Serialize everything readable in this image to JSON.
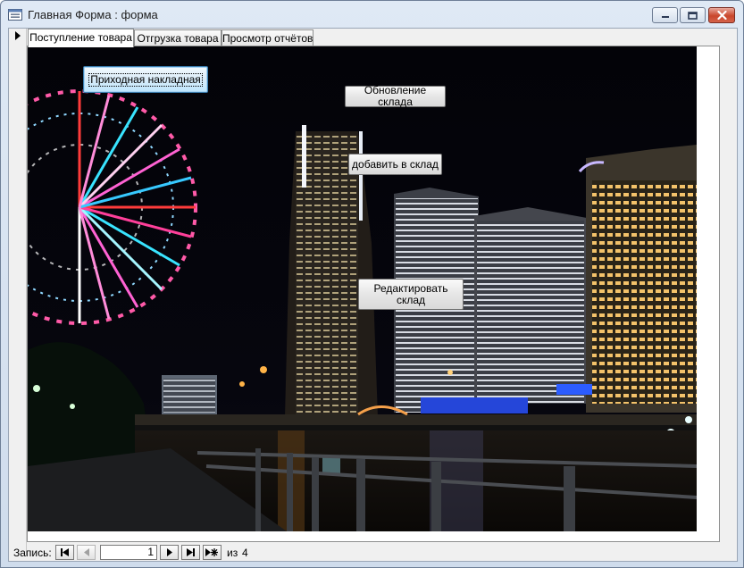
{
  "window": {
    "title": "Главная Форма : форма",
    "icon": "form-icon",
    "controls": [
      "minimize-icon",
      "maximize-icon",
      "close-icon"
    ]
  },
  "tabs": [
    {
      "label": "Поступление товара",
      "active": true
    },
    {
      "label": "Отгрузка товара",
      "active": false
    },
    {
      "label": "Просмотр отчётов",
      "active": false
    }
  ],
  "panel": {
    "background_image": "night-city-ferris-wheel",
    "buttons": {
      "incoming_invoice": "Приходная накладная",
      "update_warehouse": "Обновление склада",
      "add_to_warehouse": "добавить в склад",
      "edit_warehouse_line1": "Редактировать",
      "edit_warehouse_line2": "склад"
    }
  },
  "navigation": {
    "label": "Запись:",
    "current": "1",
    "of_label": "из",
    "total": "4",
    "buttons": [
      "first-record-icon",
      "previous-record-icon",
      "next-record-icon",
      "last-record-icon",
      "new-record-icon"
    ]
  },
  "colors": {
    "title_bar": "#dfe9f5",
    "close_button": "#c9462c",
    "focus_border": "#3c7fb1"
  }
}
